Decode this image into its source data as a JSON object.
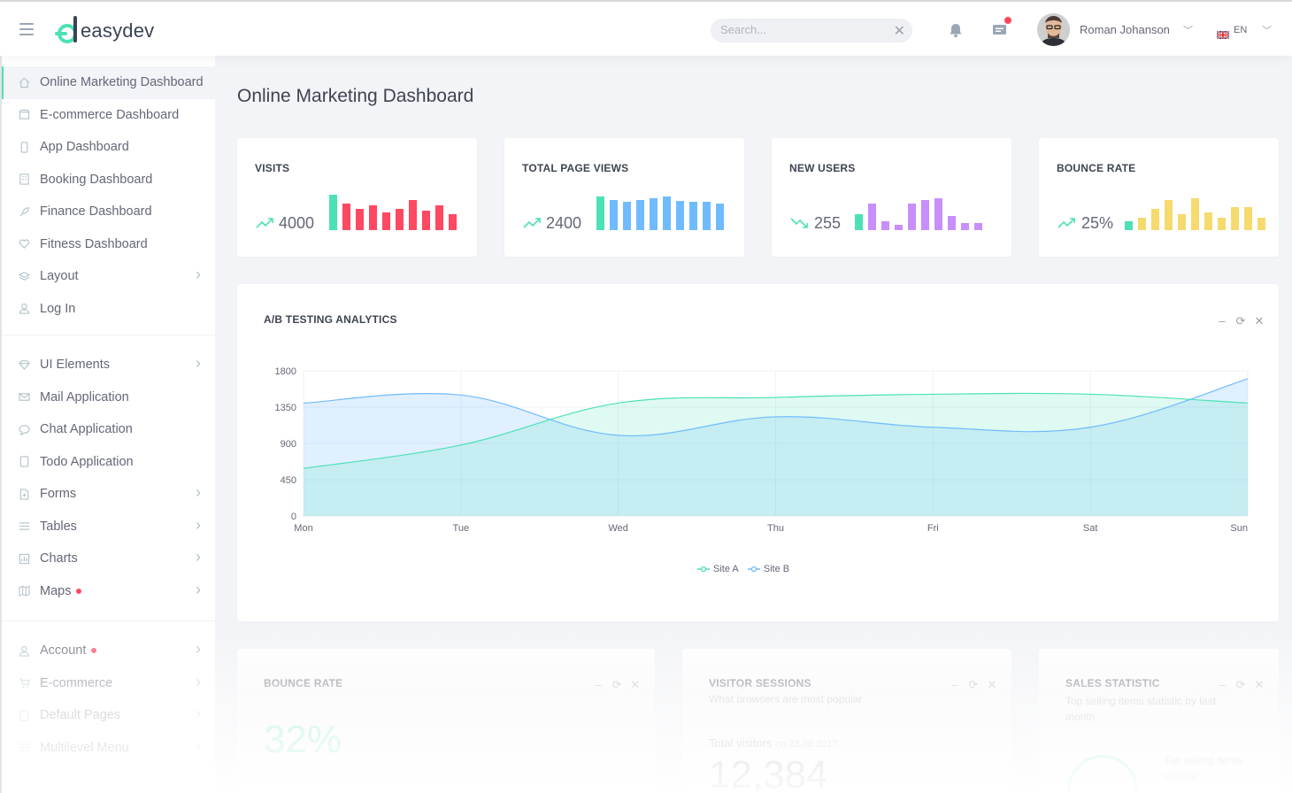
{
  "header": {
    "logo_text": "easydev",
    "search_placeholder": "Search...",
    "user_name": "Roman Johanson",
    "language": "EN"
  },
  "sidebar": {
    "group1": [
      {
        "label": "Online Marketing Dashboard",
        "icon": "home-icon",
        "active": true
      },
      {
        "label": "E-commerce Dashboard",
        "icon": "store-icon"
      },
      {
        "label": "App Dashboard",
        "icon": "phone-icon"
      },
      {
        "label": "Booking Dashboard",
        "icon": "apartment-icon"
      },
      {
        "label": "Finance Dashboard",
        "icon": "rocket-icon"
      },
      {
        "label": "Fitness Dashboard",
        "icon": "heart-pulse-icon"
      },
      {
        "label": "Layout",
        "icon": "layers-icon",
        "arrow": true
      },
      {
        "label": "Log In",
        "icon": "user-icon"
      }
    ],
    "group2": [
      {
        "label": "UI Elements",
        "icon": "diamond-icon",
        "arrow": true
      },
      {
        "label": "Mail Application",
        "icon": "envelope-icon"
      },
      {
        "label": "Chat Application",
        "icon": "bubble-icon"
      },
      {
        "label": "Todo Application",
        "icon": "todo-icon"
      },
      {
        "label": "Forms",
        "icon": "file-add-icon",
        "arrow": true
      },
      {
        "label": "Tables",
        "icon": "list-icon",
        "arrow": true
      },
      {
        "label": "Charts",
        "icon": "chart-icon",
        "arrow": true
      },
      {
        "label": "Maps",
        "icon": "map-icon",
        "arrow": true,
        "dot": true
      }
    ],
    "group3": [
      {
        "label": "Account",
        "icon": "user-icon",
        "arrow": true,
        "dot": true
      },
      {
        "label": "E-commerce",
        "icon": "cart-icon",
        "arrow": true
      },
      {
        "label": "Default Pages",
        "icon": "file-icon",
        "arrow": true
      },
      {
        "label": "Multilevel Menu",
        "icon": "menu-icon",
        "arrow": true
      }
    ]
  },
  "page_title": "Online Marketing Dashboard",
  "stats": [
    {
      "label": "VISITS",
      "value": "4000",
      "trend": "up",
      "color": "#ff4861",
      "accent": "#4ce1b6",
      "bars": [
        40,
        30,
        24,
        28,
        20,
        24,
        34,
        22,
        28,
        18
      ],
      "highlight": 0
    },
    {
      "label": "TOTAL PAGE VIEWS",
      "value": "2400",
      "trend": "up",
      "color": "#70bbfd",
      "accent": "#4ce1b6",
      "bars": [
        38,
        34,
        32,
        34,
        36,
        38,
        33,
        32,
        32,
        30
      ],
      "highlight": 0
    },
    {
      "label": "NEW USERS",
      "value": "255",
      "trend": "down",
      "color": "#c88ffa",
      "accent": "#4ce1b6",
      "bars": [
        18,
        30,
        10,
        6,
        30,
        34,
        36,
        16,
        8,
        8
      ],
      "highlight": 0
    },
    {
      "label": "BOUNCE RATE",
      "value": "25%",
      "trend": "up",
      "color": "#f6da6e",
      "accent": "#4ce1b6",
      "bars": [
        10,
        14,
        24,
        34,
        18,
        36,
        20,
        14,
        26,
        26,
        14
      ],
      "highlight": 0
    }
  ],
  "ab_panel": {
    "title": "A/B TESTING ANALYTICS"
  },
  "chart_data": {
    "type": "area",
    "title": "A/B TESTING ANALYTICS",
    "categories": [
      "Mon",
      "Tue",
      "Wed",
      "Thu",
      "Fri",
      "Sat",
      "Sun"
    ],
    "series": [
      {
        "name": "Site A",
        "values": [
          590,
          880,
          1400,
          1470,
          1510,
          1510,
          1400
        ],
        "color": "#4ce1b6"
      },
      {
        "name": "Site B",
        "values": [
          1400,
          1500,
          1000,
          1230,
          1100,
          1100,
          1700
        ],
        "color": "#70bbfd"
      }
    ],
    "yticks": [
      0,
      450,
      900,
      1350,
      1800
    ],
    "ylim": [
      0,
      1800
    ],
    "grid": true,
    "legend": "bottom-center"
  },
  "bottom_panels": [
    {
      "title": "BOUNCE RATE",
      "subtitle": "",
      "big": "32%"
    },
    {
      "title": "VISITOR SESSIONS",
      "subtitle": "What browsers are most popular",
      "note_label": "Total visitors",
      "note_date": "on 23.08.2017",
      "big": "12,384"
    },
    {
      "title": "SALES STATISTIC",
      "subtitle": "Top selling items statistic by last month",
      "inner_text": "Top selling items statistic"
    }
  ]
}
